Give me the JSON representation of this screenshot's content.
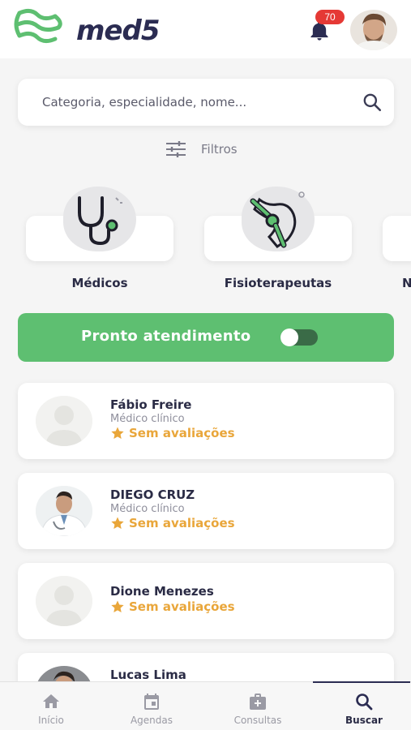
{
  "header": {
    "logo_text": "med5",
    "notification_count": "70",
    "logo_color": "#5ebf71"
  },
  "search": {
    "placeholder": "Categoria, especialidade, nome..."
  },
  "filters": {
    "label": "Filtros"
  },
  "categories": [
    {
      "label": "Médicos",
      "icon": "stethoscope-icon"
    },
    {
      "label": "Fisioterapeutas",
      "icon": "bone-joint-icon"
    },
    {
      "label": "N",
      "icon": ""
    }
  ],
  "pronto": {
    "label": "Pronto atendimento",
    "enabled": false,
    "color": "#5ebf71"
  },
  "doctors": [
    {
      "name": "Fábio Freire",
      "specialty": "Médico clínico",
      "rating": "Sem avaliações",
      "photo": "placeholder"
    },
    {
      "name": "DIEGO CRUZ",
      "specialty": "Médico clínico",
      "rating": "Sem avaliações",
      "photo": "photo"
    },
    {
      "name": "Dione Menezes",
      "specialty": "",
      "rating": "Sem avaliações",
      "photo": "placeholder"
    },
    {
      "name": "Lucas Lima",
      "specialty": "",
      "rating": "",
      "photo": "photo"
    }
  ],
  "nav": [
    {
      "label": "Início",
      "icon": "home-icon"
    },
    {
      "label": "Agendas",
      "icon": "calendar-icon"
    },
    {
      "label": "Consultas",
      "icon": "medical-kit-icon"
    },
    {
      "label": "Buscar",
      "icon": "search-icon",
      "active": true
    }
  ],
  "colors": {
    "accent": "#5ebf71",
    "rating": "#e9a63a",
    "text": "#2a2b45",
    "badge": "#e53935"
  }
}
